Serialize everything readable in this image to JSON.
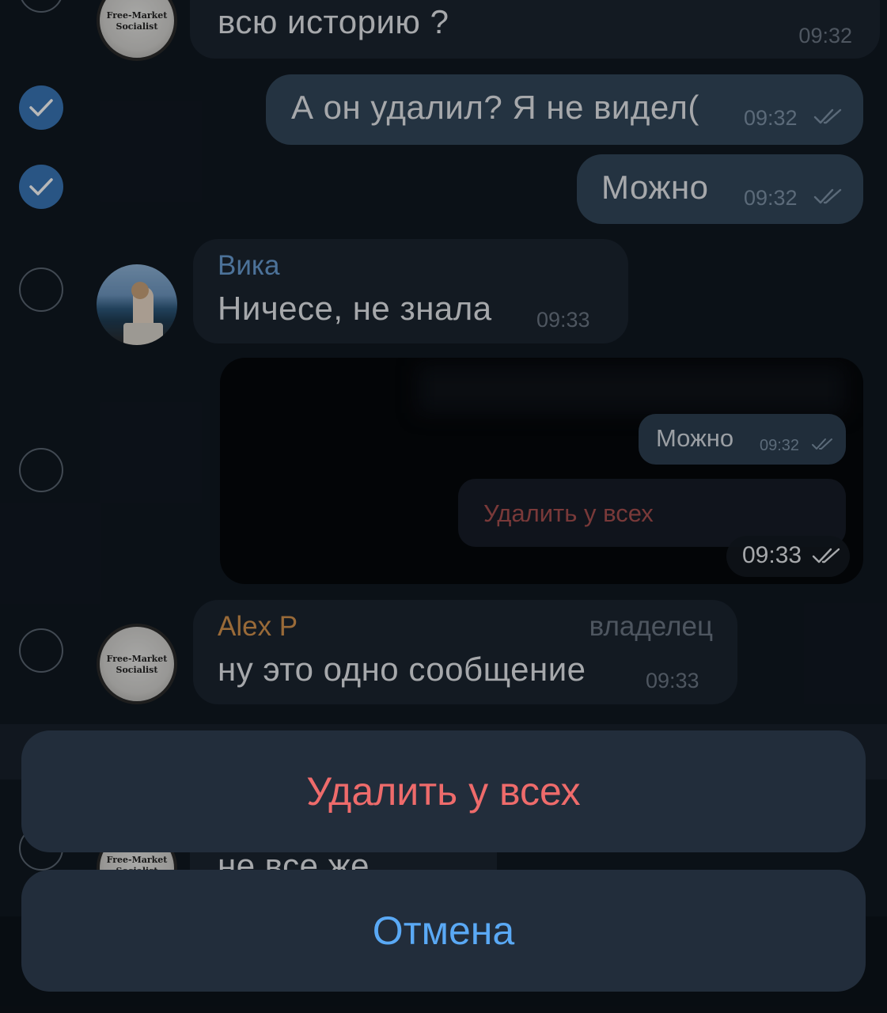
{
  "messages": [
    {
      "text": "всю историю ?",
      "time": "09:32"
    },
    {
      "text": "А он удалил? Я не видел(",
      "time": "09:32"
    },
    {
      "text": "Можно",
      "time": "09:32"
    },
    {
      "sender": "Вика",
      "text": "Ничесе, не знала",
      "time": "09:33"
    },
    {
      "time": "09:33",
      "screenshot": {
        "bubble_text": "Можно",
        "bubble_time": "09:32",
        "action_label": "Удалить у всех"
      }
    },
    {
      "sender": "Alex P",
      "role": "владелец",
      "text": "ну это одно сообщение",
      "time": "09:33"
    },
    {
      "text": "не все же"
    }
  ],
  "avatar_logo": {
    "line1": "Free-Market",
    "line2": "Socialist"
  },
  "action_sheet": {
    "delete_label": "Удалить у всех",
    "cancel_label": "Отмена"
  },
  "colors": {
    "background": "#101821",
    "incoming_bubble": "#1b2430",
    "outgoing_bubble": "#33475a",
    "check_selected": "#3a77b8",
    "sender_vika": "#6a9fd4",
    "sender_alex": "#d4944e",
    "destructive": "#ee6b6b",
    "accent": "#5aa9f5",
    "sheet_button": "#222d3b"
  },
  "icons": [
    "checkmark-icon",
    "double-check-icon"
  ]
}
